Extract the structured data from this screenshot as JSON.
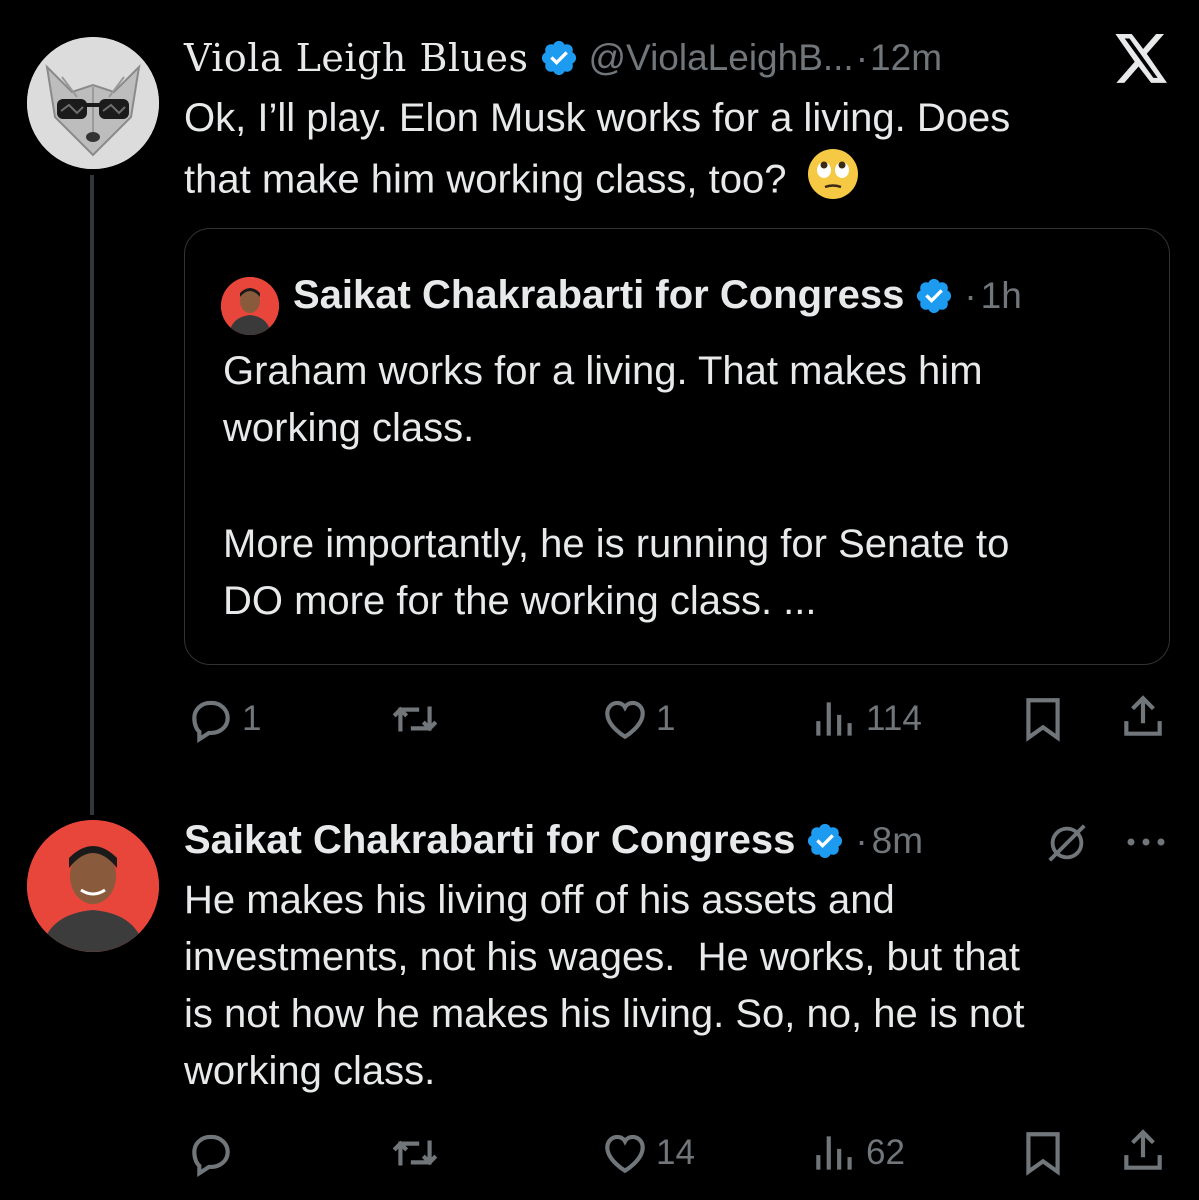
{
  "tweet1": {
    "display_name": "Viola Leigh Blues",
    "handle": "@ViolaLeighB...",
    "separator": "·",
    "time": "12m",
    "text_line1": "Ok, I’ll play. Elon Musk works for a living. Does",
    "text_line2": "that make him working class, too?",
    "emoji": "🙄",
    "quote": {
      "display_name": "Saikat Chakrabarti for Congress",
      "separator": "·",
      "time": "1h",
      "para1_line1": "Graham works for a living. That makes him",
      "para1_line2": "working class.",
      "para2_line1": "More importantly, he is running for Senate to",
      "para2_line2": "DO more for the working class. ..."
    },
    "actions": {
      "replies": "1",
      "reposts": "",
      "likes": "1",
      "views": "114"
    }
  },
  "tweet2": {
    "display_name": "Saikat Chakrabarti for Congress",
    "separator": "·",
    "time": "8m",
    "text_line1": "He makes his living off of his assets and",
    "text_line2": "investments, not his wages.  He works, but that",
    "text_line3": "is not how he makes his living. So, no, he is not",
    "text_line4": "working class.",
    "actions": {
      "replies": "",
      "reposts": "",
      "likes": "14",
      "views": "62"
    }
  },
  "icons": {
    "x_logo": "x-logo-icon",
    "verified": "verified-badge-icon",
    "reply": "reply-icon",
    "repost": "repost-icon",
    "like": "heart-icon",
    "views": "views-icon",
    "bookmark": "bookmark-icon",
    "share": "share-icon",
    "grok": "grok-icon",
    "more": "more-icon"
  },
  "colors": {
    "background": "#000000",
    "text": "#e7e9ea",
    "muted": "#71767b",
    "verified": "#1d9bf0",
    "avatar_red": "#e8463b"
  }
}
